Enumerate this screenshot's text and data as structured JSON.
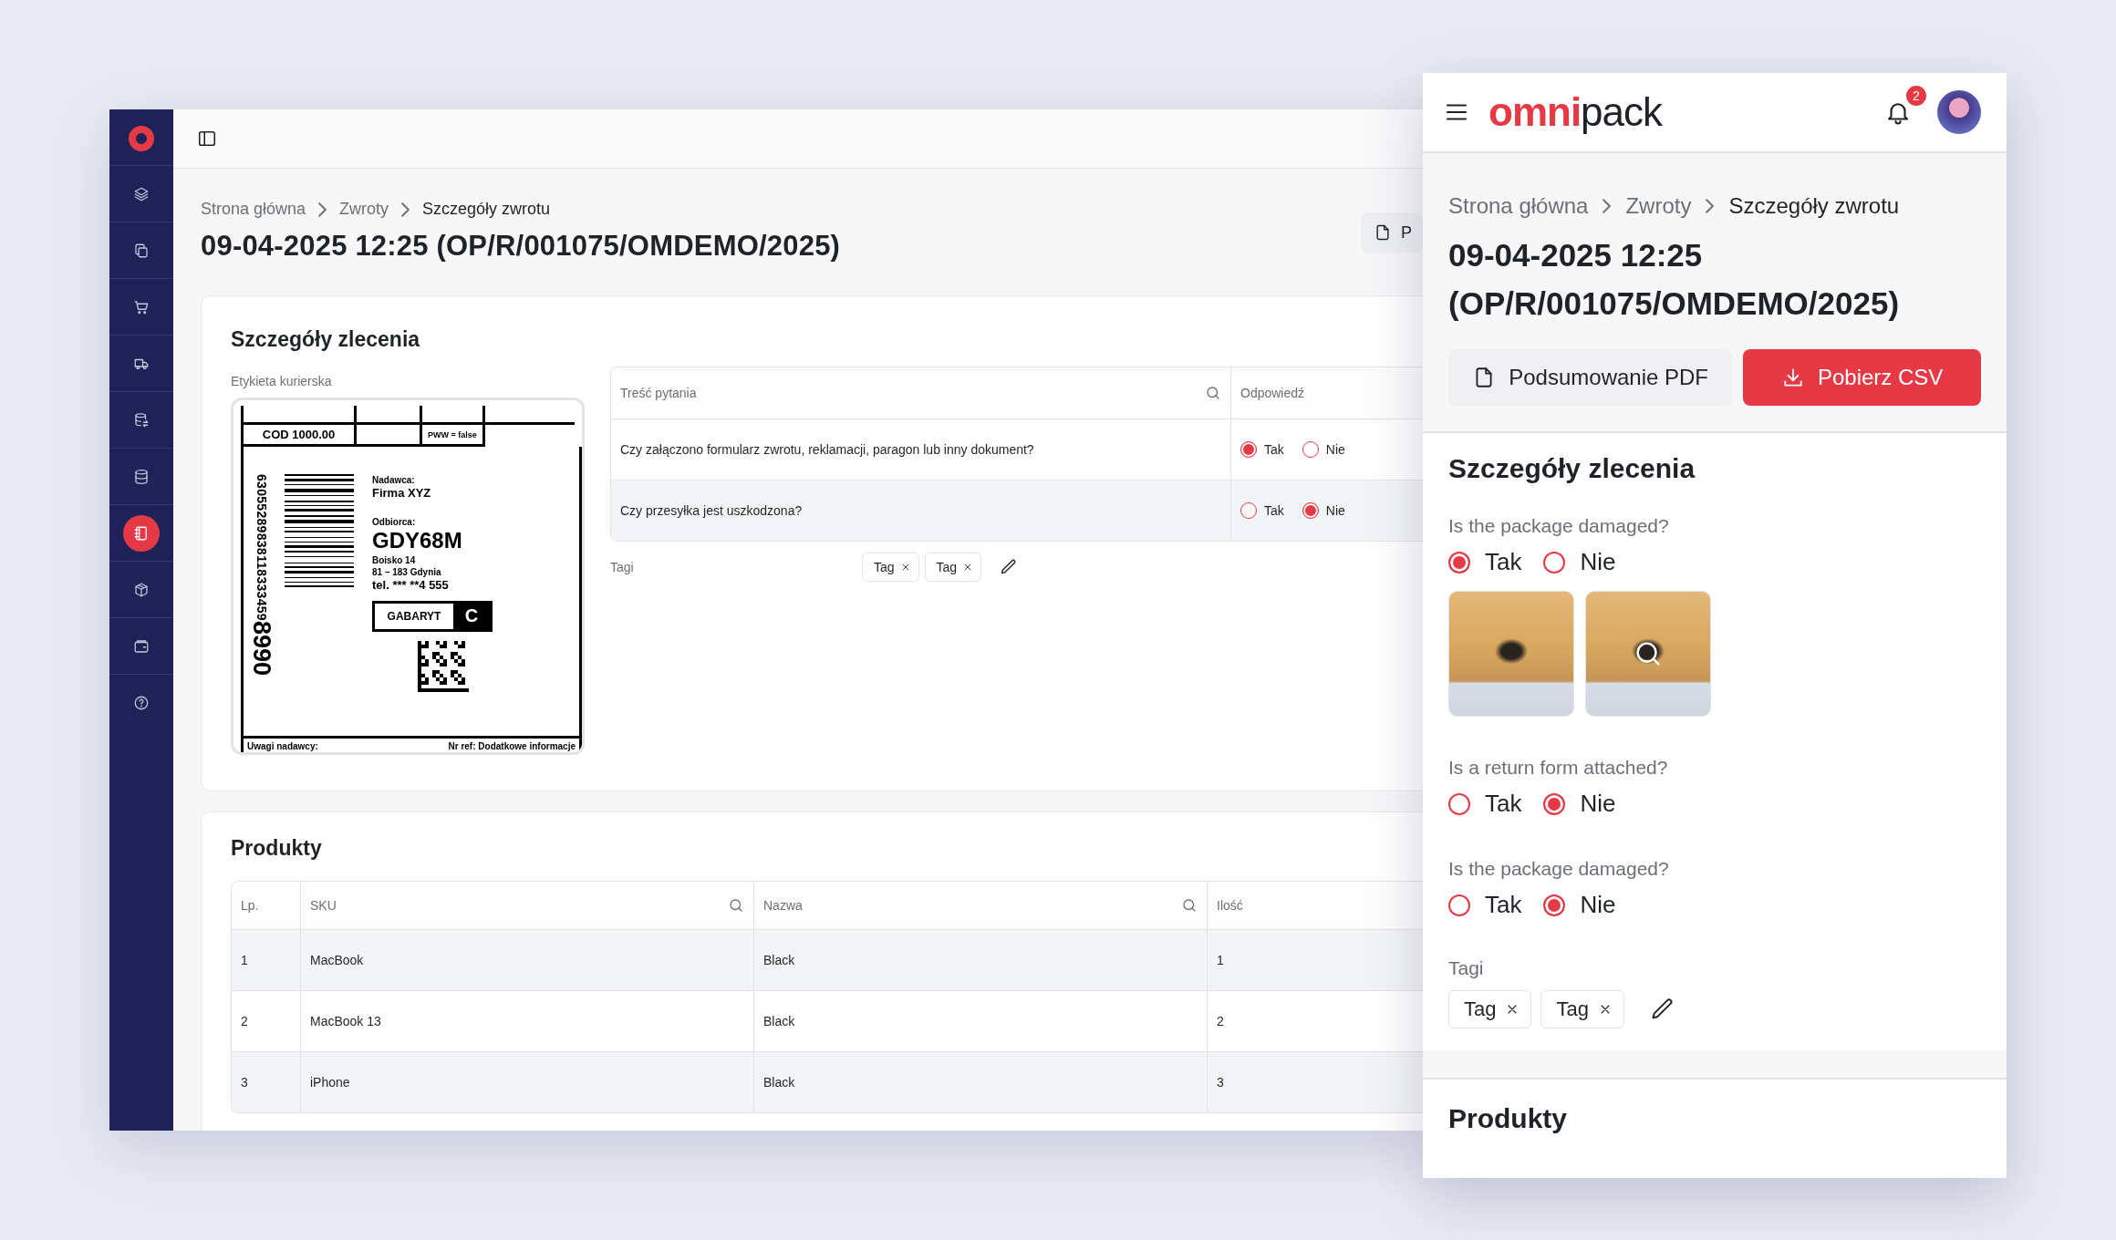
{
  "desktop": {
    "sidebar": {
      "items": [
        {
          "kind": "layers",
          "selected": false
        },
        {
          "kind": "copy",
          "selected": false
        },
        {
          "kind": "cart",
          "selected": false
        },
        {
          "kind": "truck",
          "selected": false
        },
        {
          "kind": "database-sync",
          "selected": false
        },
        {
          "kind": "database",
          "selected": false
        },
        {
          "kind": "notebook",
          "selected": true
        },
        {
          "kind": "box",
          "selected": false
        },
        {
          "kind": "wallet",
          "selected": false
        },
        {
          "kind": "help",
          "selected": false
        }
      ]
    },
    "breadcrumb": [
      {
        "label": "Strona główna",
        "current": false
      },
      {
        "label": "Zwroty",
        "current": false
      },
      {
        "label": "Szczegóły zwrotu",
        "current": true
      }
    ],
    "title": "09-04-2025 12:25 (OP/R/001075/OMDEMO/2025)",
    "pdf_button": "P",
    "order_card": {
      "title": "Szczegóły zlecenia",
      "label_caption": "Etykieta kurierska",
      "label": {
        "cod": "COD 1000.00",
        "pww": "PWW = false",
        "tracking_number": "63055289838118333459",
        "tracking_suffix": "8990",
        "sender_label": "Nadawca:",
        "sender": "Firma XYZ",
        "recipient_label": "Odbiorca:",
        "recipient_code": "GDY68M",
        "address": [
          "Boisko 14",
          "81 – 183 Gdynia",
          "tel. *** **4 555"
        ],
        "size_label": "GABARYT",
        "size": "C",
        "notes_label": "Uwagi nadawcy:",
        "reference": "Nr ref: Dodatkowe informacje"
      },
      "questions": {
        "columns": [
          {
            "label": "Treść pytania",
            "searchable": true
          },
          {
            "label": "Odpowiedź",
            "searchable": false
          }
        ],
        "rows": [
          {
            "question": "Czy załączono formularz zwrotu, reklamacji, paragon lub inny dokument?",
            "options": [
              {
                "label": "Tak",
                "selected": true
              },
              {
                "label": "Nie",
                "selected": false
              }
            ]
          },
          {
            "question": "Czy przesyłka jest uszkodzona?",
            "options": [
              {
                "label": "Tak",
                "selected": false
              },
              {
                "label": "Nie",
                "selected": true
              }
            ]
          }
        ]
      },
      "tags_label": "Tagi",
      "tags": [
        "Tag",
        "Tag"
      ]
    },
    "products": {
      "title": "Produkty",
      "columns": [
        {
          "label": "Lp.",
          "searchable": false
        },
        {
          "label": "SKU",
          "searchable": true
        },
        {
          "label": "Nazwa",
          "searchable": true
        },
        {
          "label": "Ilość",
          "searchable": false
        }
      ],
      "rows": [
        [
          "1",
          "MacBook",
          "Black",
          "1"
        ],
        [
          "2",
          "MacBook 13",
          "Black",
          "2"
        ],
        [
          "3",
          "iPhone",
          "Black",
          "3"
        ]
      ]
    }
  },
  "mobile": {
    "logo": {
      "brand": "omni",
      "suffix": "pack"
    },
    "notifications": "2",
    "breadcrumb": [
      {
        "label": "Strona główna",
        "current": false
      },
      {
        "label": "Zwroty",
        "current": false
      },
      {
        "label": "Szczegóły zwrotu",
        "current": true
      }
    ],
    "title": "09-04-2025 12:25 (OP/R/001075/OMDEMO/2025)",
    "buttons": [
      {
        "kind": "secondary",
        "label": "Podsumowanie PDF"
      },
      {
        "kind": "primary",
        "label": "Pobierz CSV"
      }
    ],
    "order_card": {
      "title": "Szczegóły zlecenia",
      "questions": [
        {
          "question": "Is the package damaged?",
          "options": [
            {
              "label": "Tak",
              "selected": true
            },
            {
              "label": "Nie",
              "selected": false
            }
          ],
          "photos": [
            {
              "hovered": false
            },
            {
              "hovered": true
            }
          ]
        },
        {
          "question": "Is a return form attached?",
          "options": [
            {
              "label": "Tak",
              "selected": false
            },
            {
              "label": "Nie",
              "selected": true
            }
          ]
        },
        {
          "question": "Is the package damaged?",
          "options": [
            {
              "label": "Tak",
              "selected": false
            },
            {
              "label": "Nie",
              "selected": true
            }
          ]
        }
      ],
      "tags_label": "Tagi",
      "tags": [
        "Tag",
        "Tag"
      ]
    },
    "products_title": "Produkty"
  }
}
